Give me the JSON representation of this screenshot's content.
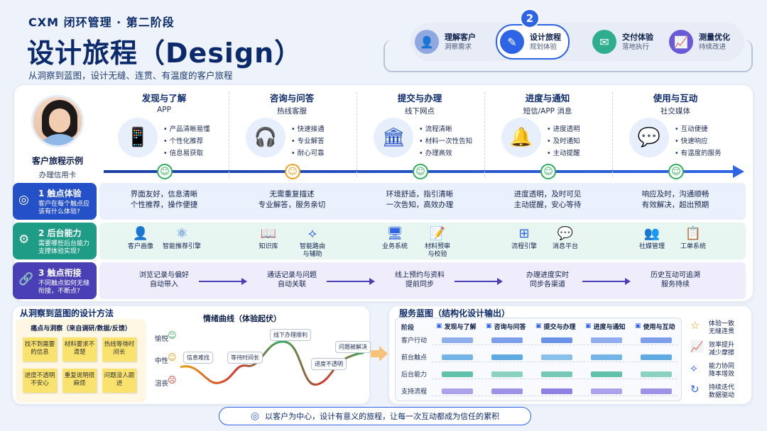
{
  "header": {
    "eyebrow": "CXM 闭环管理 · 第二阶段",
    "title": "设计旅程（Design）",
    "subtitle": "从洞察到蓝图，设计无缝、连贯、有温度的客户旅程"
  },
  "stages": {
    "active_number": "2",
    "items": [
      {
        "name": "理解客户",
        "desc": "洞察需求",
        "color": "#6f8fd8",
        "glyph": "👤"
      },
      {
        "name": "设计旅程",
        "desc": "规划体验",
        "color": "#2e64e6",
        "glyph": "✎"
      },
      {
        "name": "交付体验",
        "desc": "落地执行",
        "color": "#2fae8f",
        "glyph": "✉"
      },
      {
        "name": "测量优化",
        "desc": "持续改进",
        "color": "#6a5ad8",
        "glyph": "📈"
      }
    ]
  },
  "persona": {
    "label": "客户旅程示例",
    "task": "办理信用卡"
  },
  "touchpoints": [
    {
      "title": "发现与了解",
      "channel": "APP",
      "icon": "phone-icon",
      "glyph": "📱",
      "bullets": [
        "产品清晰易懂",
        "个性化推荐",
        "信息易获取"
      ],
      "smile": "☺",
      "smile_color": "#2fae5a"
    },
    {
      "title": "咨询与问答",
      "channel": "热线客服",
      "icon": "headset-icon",
      "glyph": "🎧",
      "bullets": [
        "快速接通",
        "专业解答",
        "耐心可靠"
      ],
      "smile": "☺",
      "smile_color": "#f0a020"
    },
    {
      "title": "提交与办理",
      "channel": "线下网点",
      "icon": "bank-icon",
      "glyph": "🏛",
      "bullets": [
        "流程清晰",
        "材料一次性告知",
        "办理高效"
      ],
      "smile": "☺",
      "smile_color": "#2fae5a"
    },
    {
      "title": "进度与通知",
      "channel": "短信/APP 消息",
      "icon": "bell-icon",
      "glyph": "🔔",
      "bullets": [
        "进度透明",
        "及时通知",
        "主动提醒"
      ],
      "smile": "☺",
      "smile_color": "#2fae5a"
    },
    {
      "title": "使用与互动",
      "channel": "社交媒体",
      "icon": "chat-icon",
      "glyph": "💬",
      "bullets": [
        "互动便捷",
        "快速响应",
        "有温度的服务"
      ],
      "smile": "☺",
      "smile_color": "#2fae5a"
    }
  ],
  "rows": {
    "experience": {
      "num": "1 触点体验",
      "desc": "客户在每个触点应该有什么体验?",
      "glyph": "◎",
      "cells": [
        "界面友好，信息清晰\n个性推荐，操作便捷",
        "无需重复描述\n专业解答，服务亲切",
        "环境舒适，指引清晰\n一次告知，高效办理",
        "进度透明，及时可见\n主动提醒，安心等待",
        "响应及时，沟通顺畅\n有效解决，超出预期"
      ]
    },
    "backend": {
      "num": "2 后台能力",
      "desc": "需要哪些后台能力支撑体验实现?",
      "glyph": "⚙",
      "caps": [
        {
          "label": "客户画像",
          "glyph": "👤"
        },
        {
          "label": "智能推荐引擎",
          "glyph": "⚛"
        },
        {
          "label": "知识库",
          "glyph": "📖"
        },
        {
          "label": "智能路由\n与辅助",
          "glyph": "⟡"
        },
        {
          "label": "业务系统",
          "glyph": "🖥"
        },
        {
          "label": "材料预审\n与校验",
          "glyph": "📝"
        },
        {
          "label": "流程引擎",
          "glyph": "⊞"
        },
        {
          "label": "消息平台",
          "glyph": "💬"
        },
        {
          "label": "社媒管理",
          "glyph": "👥"
        },
        {
          "label": "工单系统",
          "glyph": "📋"
        }
      ]
    },
    "connect": {
      "num": "3 触点衔接",
      "desc": "不同触点如何无缝衔接，不断点?",
      "glyph": "🔗",
      "items": [
        "浏览记录与偏好\n自动带入",
        "通话记录与问题\n自动关联",
        "线上预约与资料\n提前同步",
        "办理进度实时\n同步各渠道",
        "历史互动可追溯\n服务持续"
      ]
    }
  },
  "method": {
    "title": "从洞察到蓝图的设计方法",
    "notes_title": "痛点与洞察（来自调研/数据/反馈）",
    "notes": [
      "找不到需要的信息",
      "材料要求不清楚",
      "热线等待时间长",
      "进度不透明不安心",
      "重复说明很麻烦",
      "问题没人跟进"
    ],
    "curve_title": "情绪曲线（体验起伏）",
    "levels": [
      "愉悦",
      "中性",
      "沮丧"
    ],
    "bubbles": [
      "信息难找",
      "等待时间长",
      "线下办理顺利",
      "进度不透明",
      "问题被解决"
    ]
  },
  "blueprint": {
    "title": "服务蓝图（结构化设计输出）",
    "corner": "阶段",
    "stages": [
      "发现与了解",
      "咨询与问答",
      "提交与办理",
      "进度与通知",
      "使用与互动"
    ],
    "rows": [
      "客户行动",
      "前台触点",
      "后台能力",
      "支持流程"
    ],
    "row_colors": [
      "#3a6fe0",
      "#2e8fd8",
      "#2fae8f",
      "#6a5ad8"
    ],
    "legend": [
      {
        "label": "体验一致\n无缝连贯",
        "glyph": "☆",
        "color": "#e8a010"
      },
      {
        "label": "效率提升\n减少摩擦",
        "glyph": "📈",
        "color": "#2fae5a"
      },
      {
        "label": "能力协同\n降本增效",
        "glyph": "⟡",
        "color": "#2e64e6"
      },
      {
        "label": "持续迭代\n数据驱动",
        "glyph": "↻",
        "color": "#2e64e6"
      }
    ]
  },
  "footer": {
    "text": "以客户为中心，设计有意义的旅程，让每一次互动都成为信任的累积",
    "glyph": "◎"
  }
}
